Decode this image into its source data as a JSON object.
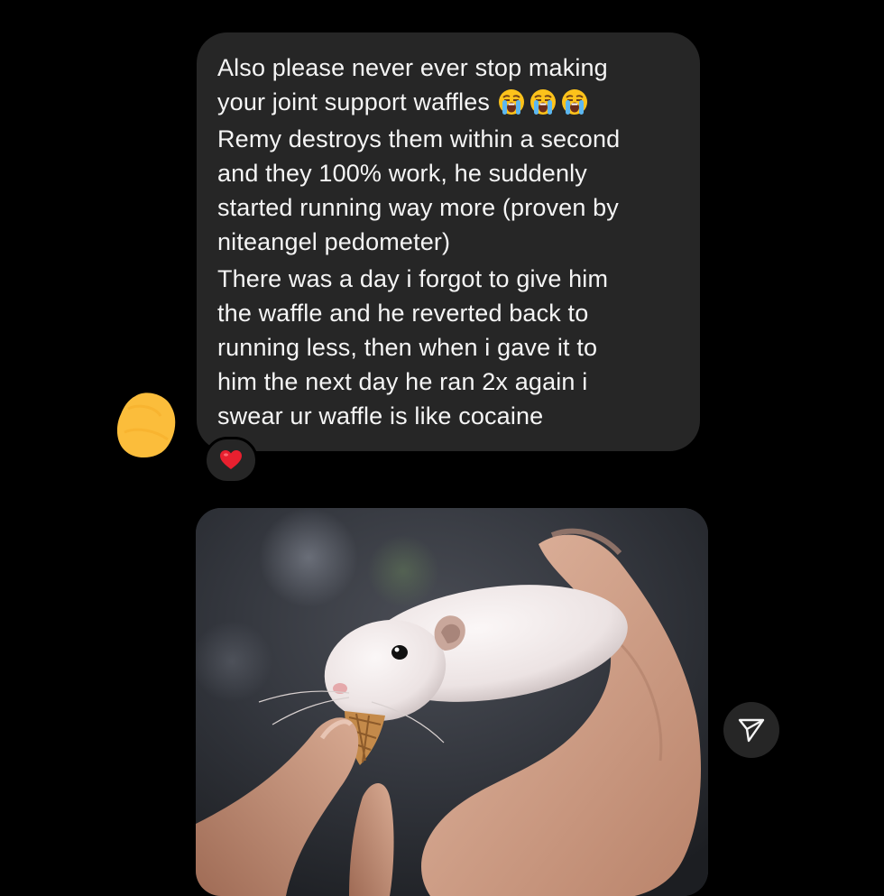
{
  "message": {
    "paragraphs": [
      "Also please never ever stop making\nyour joint support waffles",
      "Remy destroys them within a second\nand they 100% work, he suddenly\nstarted running way more (proven by\nniteangel pedometer)",
      "There was a day i forgot to give him\nthe waffle and he reverted back to\nrunning less, then when i gave it to\nhim the next day he ran 2x again i\nswear ur waffle is like cocaine"
    ],
    "emojis": [
      "loudly-crying-face",
      "loudly-crying-face",
      "loudly-crying-face"
    ],
    "reaction": "red-heart",
    "bubble_color": "#262626",
    "text_color": "#f5f5f5"
  },
  "avatar": {
    "redaction_color": "#fbbd3b"
  },
  "attachment": {
    "type": "photo",
    "subject": "white hamster eating a small waffle cone held by fingers"
  },
  "actions": {
    "share_icon": "paper-plane-icon"
  }
}
